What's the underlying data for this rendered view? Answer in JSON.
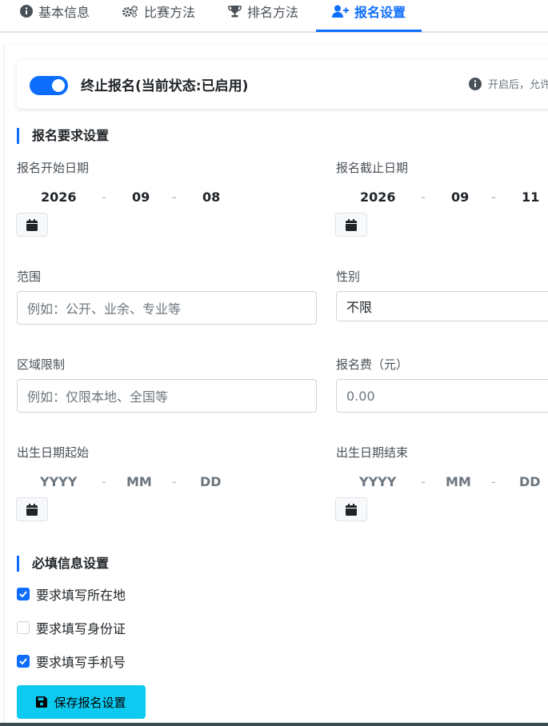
{
  "tabs": [
    {
      "label": "基本信息",
      "active": false
    },
    {
      "label": "比赛方法",
      "active": false
    },
    {
      "label": "排名方法",
      "active": false
    },
    {
      "label": "报名设置",
      "active": true
    }
  ],
  "status": {
    "switch_on": true,
    "label": "终止报名(当前状态:已启用)",
    "hint": "开启后，允许"
  },
  "sections": {
    "requirements": "报名要求设置",
    "required_info": "必填信息设置"
  },
  "start_date": {
    "label": "报名开始日期",
    "year": "2026",
    "month": "09",
    "day": "08",
    "sep": "-"
  },
  "end_date": {
    "label": "报名截止日期",
    "year": "2026",
    "month": "09",
    "day": "11",
    "sep": "-"
  },
  "scope": {
    "label": "范围",
    "placeholder": "例如：公开、业余、专业等"
  },
  "gender": {
    "label": "性别",
    "value": "不限"
  },
  "region": {
    "label": "区域限制",
    "placeholder": "例如：仅限本地、全国等"
  },
  "fee": {
    "label": "报名费（元）",
    "placeholder": "0.00"
  },
  "birth_start": {
    "label": "出生日期起始",
    "year": "YYYY",
    "month": "MM",
    "day": "DD",
    "sep": "-"
  },
  "birth_end": {
    "label": "出生日期结束",
    "year": "YYYY",
    "month": "MM",
    "day": "DD",
    "sep": "-"
  },
  "checks": [
    {
      "label": "要求填写所在地",
      "checked": true
    },
    {
      "label": "要求填写身份证",
      "checked": false
    },
    {
      "label": "要求填写手机号",
      "checked": true
    }
  ],
  "save_label": "保存报名设置",
  "colors": {
    "accent": "#0d6efd",
    "save": "#0dcaf0"
  },
  "icons": {
    "tab1": "info-circle-icon",
    "tab2": "gears-icon",
    "tab3": "trophy-icon",
    "tab4": "user-plus-icon",
    "calendar": "calendar-icon",
    "save": "floppy-disk-icon"
  }
}
